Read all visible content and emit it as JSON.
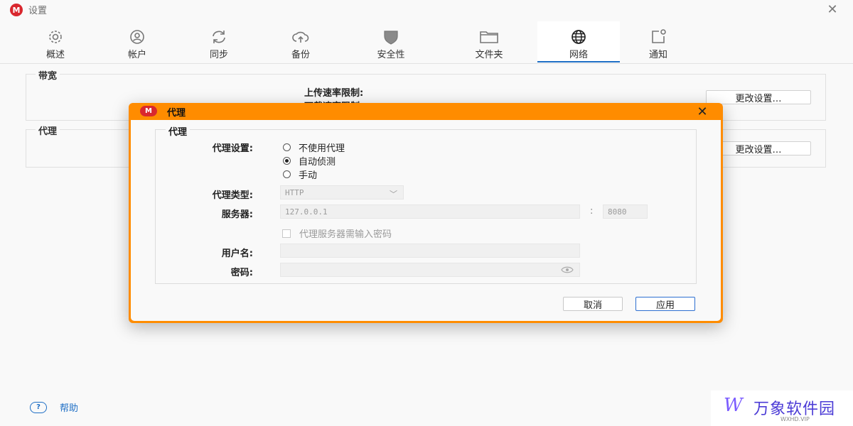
{
  "window": {
    "logo_text": "M",
    "title": "设置",
    "close_glyph": "✕"
  },
  "tabs": [
    {
      "label": "概述",
      "icon": "gear-icon"
    },
    {
      "label": "帐户",
      "icon": "account-icon"
    },
    {
      "label": "同步",
      "icon": "sync-icon"
    },
    {
      "label": "备份",
      "icon": "cloud-upload-icon"
    },
    {
      "label": "安全性",
      "icon": "shield-icon"
    },
    {
      "label": "文件夹",
      "icon": "folder-icon"
    },
    {
      "label": "网络",
      "icon": "globe-icon",
      "active": true
    },
    {
      "label": "通知",
      "icon": "notification-icon"
    }
  ],
  "bandwidth": {
    "title": "带宽",
    "upload_label": "上传速率限制:",
    "download_label": "下载速率限制",
    "change_button": "更改设置…"
  },
  "proxy_section": {
    "title": "代理",
    "change_button": "更改设置…"
  },
  "help": {
    "icon_text": "?",
    "label": "帮助"
  },
  "watermark": {
    "logo": "W",
    "text": "万象软件园",
    "sub": "WXHD.VIP"
  },
  "dialog": {
    "logo_text": "M",
    "title": "代理",
    "close_glyph": "✕",
    "group_title": "代理",
    "proxy_setting_label": "代理设置:",
    "options": [
      {
        "label": "不使用代理",
        "selected": false
      },
      {
        "label": "自动侦测",
        "selected": true
      },
      {
        "label": "手动",
        "selected": false
      }
    ],
    "proxy_type_label": "代理类型:",
    "proxy_type_value": "HTTP",
    "server_label": "服务器:",
    "server_value": "127.0.0.1",
    "port_separator": ":",
    "port_value": "8080",
    "auth_checkbox_label": "代理服务器需输入密码",
    "username_label": "用户名:",
    "username_value": "",
    "password_label": "密码:",
    "password_value": "",
    "cancel_button": "取消",
    "apply_button": "应用"
  },
  "colors": {
    "dialog_frame": "#ff8c00",
    "accent": "#1f6fc5",
    "logo_red": "#d9272e"
  }
}
